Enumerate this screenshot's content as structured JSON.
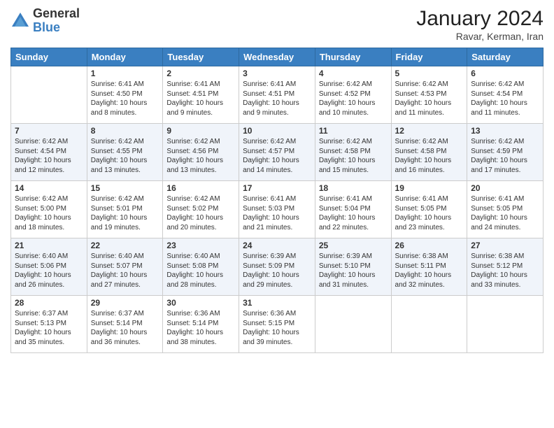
{
  "logo": {
    "general": "General",
    "blue": "Blue"
  },
  "title": {
    "month_year": "January 2024",
    "location": "Ravar, Kerman, Iran"
  },
  "weekdays": [
    "Sunday",
    "Monday",
    "Tuesday",
    "Wednesday",
    "Thursday",
    "Friday",
    "Saturday"
  ],
  "weeks": [
    [
      {
        "day": "",
        "info": ""
      },
      {
        "day": "1",
        "info": "Sunrise: 6:41 AM\nSunset: 4:50 PM\nDaylight: 10 hours\nand 8 minutes."
      },
      {
        "day": "2",
        "info": "Sunrise: 6:41 AM\nSunset: 4:51 PM\nDaylight: 10 hours\nand 9 minutes."
      },
      {
        "day": "3",
        "info": "Sunrise: 6:41 AM\nSunset: 4:51 PM\nDaylight: 10 hours\nand 9 minutes."
      },
      {
        "day": "4",
        "info": "Sunrise: 6:42 AM\nSunset: 4:52 PM\nDaylight: 10 hours\nand 10 minutes."
      },
      {
        "day": "5",
        "info": "Sunrise: 6:42 AM\nSunset: 4:53 PM\nDaylight: 10 hours\nand 11 minutes."
      },
      {
        "day": "6",
        "info": "Sunrise: 6:42 AM\nSunset: 4:54 PM\nDaylight: 10 hours\nand 11 minutes."
      }
    ],
    [
      {
        "day": "7",
        "info": "Sunrise: 6:42 AM\nSunset: 4:54 PM\nDaylight: 10 hours\nand 12 minutes."
      },
      {
        "day": "8",
        "info": "Sunrise: 6:42 AM\nSunset: 4:55 PM\nDaylight: 10 hours\nand 13 minutes."
      },
      {
        "day": "9",
        "info": "Sunrise: 6:42 AM\nSunset: 4:56 PM\nDaylight: 10 hours\nand 13 minutes."
      },
      {
        "day": "10",
        "info": "Sunrise: 6:42 AM\nSunset: 4:57 PM\nDaylight: 10 hours\nand 14 minutes."
      },
      {
        "day": "11",
        "info": "Sunrise: 6:42 AM\nSunset: 4:58 PM\nDaylight: 10 hours\nand 15 minutes."
      },
      {
        "day": "12",
        "info": "Sunrise: 6:42 AM\nSunset: 4:58 PM\nDaylight: 10 hours\nand 16 minutes."
      },
      {
        "day": "13",
        "info": "Sunrise: 6:42 AM\nSunset: 4:59 PM\nDaylight: 10 hours\nand 17 minutes."
      }
    ],
    [
      {
        "day": "14",
        "info": "Sunrise: 6:42 AM\nSunset: 5:00 PM\nDaylight: 10 hours\nand 18 minutes."
      },
      {
        "day": "15",
        "info": "Sunrise: 6:42 AM\nSunset: 5:01 PM\nDaylight: 10 hours\nand 19 minutes."
      },
      {
        "day": "16",
        "info": "Sunrise: 6:42 AM\nSunset: 5:02 PM\nDaylight: 10 hours\nand 20 minutes."
      },
      {
        "day": "17",
        "info": "Sunrise: 6:41 AM\nSunset: 5:03 PM\nDaylight: 10 hours\nand 21 minutes."
      },
      {
        "day": "18",
        "info": "Sunrise: 6:41 AM\nSunset: 5:04 PM\nDaylight: 10 hours\nand 22 minutes."
      },
      {
        "day": "19",
        "info": "Sunrise: 6:41 AM\nSunset: 5:05 PM\nDaylight: 10 hours\nand 23 minutes."
      },
      {
        "day": "20",
        "info": "Sunrise: 6:41 AM\nSunset: 5:05 PM\nDaylight: 10 hours\nand 24 minutes."
      }
    ],
    [
      {
        "day": "21",
        "info": "Sunrise: 6:40 AM\nSunset: 5:06 PM\nDaylight: 10 hours\nand 26 minutes."
      },
      {
        "day": "22",
        "info": "Sunrise: 6:40 AM\nSunset: 5:07 PM\nDaylight: 10 hours\nand 27 minutes."
      },
      {
        "day": "23",
        "info": "Sunrise: 6:40 AM\nSunset: 5:08 PM\nDaylight: 10 hours\nand 28 minutes."
      },
      {
        "day": "24",
        "info": "Sunrise: 6:39 AM\nSunset: 5:09 PM\nDaylight: 10 hours\nand 29 minutes."
      },
      {
        "day": "25",
        "info": "Sunrise: 6:39 AM\nSunset: 5:10 PM\nDaylight: 10 hours\nand 31 minutes."
      },
      {
        "day": "26",
        "info": "Sunrise: 6:38 AM\nSunset: 5:11 PM\nDaylight: 10 hours\nand 32 minutes."
      },
      {
        "day": "27",
        "info": "Sunrise: 6:38 AM\nSunset: 5:12 PM\nDaylight: 10 hours\nand 33 minutes."
      }
    ],
    [
      {
        "day": "28",
        "info": "Sunrise: 6:37 AM\nSunset: 5:13 PM\nDaylight: 10 hours\nand 35 minutes."
      },
      {
        "day": "29",
        "info": "Sunrise: 6:37 AM\nSunset: 5:14 PM\nDaylight: 10 hours\nand 36 minutes."
      },
      {
        "day": "30",
        "info": "Sunrise: 6:36 AM\nSunset: 5:14 PM\nDaylight: 10 hours\nand 38 minutes."
      },
      {
        "day": "31",
        "info": "Sunrise: 6:36 AM\nSunset: 5:15 PM\nDaylight: 10 hours\nand 39 minutes."
      },
      {
        "day": "",
        "info": ""
      },
      {
        "day": "",
        "info": ""
      },
      {
        "day": "",
        "info": ""
      }
    ]
  ]
}
